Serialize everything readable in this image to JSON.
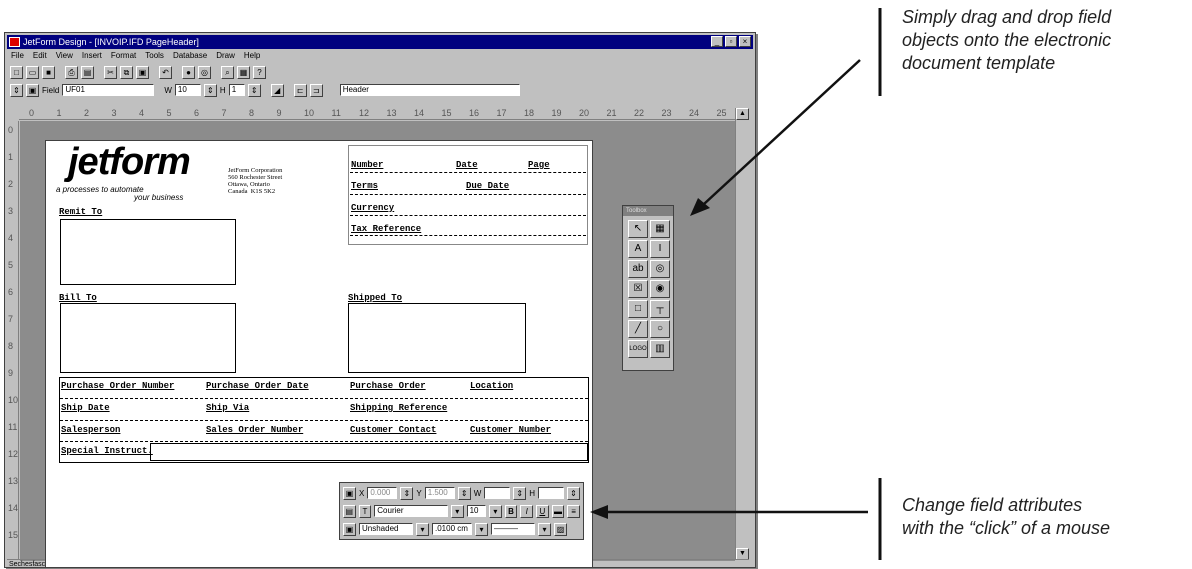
{
  "window": {
    "title": "JetForm Design - [INVOIP.IFD PageHeader]",
    "menus": [
      "File",
      "Edit",
      "View",
      "Insert",
      "Format",
      "Tools",
      "Database",
      "Draw",
      "Help"
    ]
  },
  "toolbar2": {
    "field_label": "Field",
    "field_value": "UF01",
    "width_label": "W",
    "width_value": "10",
    "height_label": "H",
    "height_value": "1",
    "section_value": "Header"
  },
  "ruler": {
    "h": [
      "0",
      "1",
      "2",
      "3",
      "4",
      "5",
      "6",
      "7",
      "8",
      "9",
      "10",
      "11",
      "12",
      "13",
      "14",
      "15",
      "16",
      "17",
      "18",
      "19",
      "20",
      "21",
      "22",
      "23",
      "24",
      "25"
    ],
    "v": [
      "0",
      "1",
      "2",
      "3",
      "4",
      "5",
      "6",
      "7",
      "8",
      "9",
      "10",
      "11",
      "12",
      "13",
      "14",
      "15"
    ]
  },
  "document": {
    "logo": "jetform",
    "tagline_1": "a processes to automate",
    "tagline_2": "your business",
    "address": "JetForm Corporation\n560 Rochester Street\nOttawa, Ontario\nCanada  K1S 5K2",
    "fields": {
      "number": "Number",
      "date": "Date",
      "page": "Page",
      "terms": "Terms",
      "due_date": "Due Date",
      "currency": "Currency",
      "tax_reference": "Tax Reference",
      "remit_to": "Remit To",
      "bill_to": "Bill To",
      "shipped_to": "Shipped To",
      "purchase_order_number": "Purchase Order Number",
      "purchase_order_date": "Purchase Order Date",
      "purchase_order": "Purchase Order",
      "location": "Location",
      "ship_date": "Ship Date",
      "ship_via": "Ship Via",
      "shipping_reference": "Shipping Reference",
      "salesperson": "Salesperson",
      "sales_order_number": "Sales Order Number",
      "customer_contact": "Customer Contact",
      "customer_number": "Customer Number",
      "special_instruct": "Special Instruct."
    }
  },
  "toolbox": {
    "title": "Toolbox",
    "tools": [
      {
        "icon": "pointer-icon",
        "glyph": "↖"
      },
      {
        "icon": "table-icon",
        "glyph": "▦"
      },
      {
        "icon": "text-icon",
        "glyph": "A"
      },
      {
        "icon": "ibeam-icon",
        "glyph": "I"
      },
      {
        "icon": "field-icon",
        "glyph": "ab"
      },
      {
        "icon": "picture-icon",
        "glyph": "◎"
      },
      {
        "icon": "checkbox-icon",
        "glyph": "☒"
      },
      {
        "icon": "radio-icon",
        "glyph": "◉"
      },
      {
        "icon": "box-icon",
        "glyph": "□"
      },
      {
        "icon": "line-tee-icon",
        "glyph": "┬"
      },
      {
        "icon": "diagonal-line-icon",
        "glyph": "╱"
      },
      {
        "icon": "circle-icon",
        "glyph": "○"
      },
      {
        "icon": "logo-icon",
        "glyph": "LOGO"
      },
      {
        "icon": "barcode-icon",
        "glyph": "▥"
      }
    ]
  },
  "attributes": {
    "x_label": "X",
    "x_value": "0.000",
    "y_label": "Y",
    "y_value": "1.500",
    "w_label": "W",
    "h_label": "H",
    "font_value": "Courier",
    "size_value": "10",
    "bold": "B",
    "italic": "I",
    "underline": "U",
    "frame_value": "Unshaded",
    "line_value": ".0100 cm"
  },
  "status": {
    "text": "Sechesfasc - Generic Microsoft Windows Driver"
  },
  "callouts": {
    "top": [
      "Simply drag and drop field",
      "objects onto the electronic",
      "document template"
    ],
    "bottom": [
      "Change field attributes",
      "with the “click” of a mouse"
    ]
  },
  "colors": {
    "titlebar": "#00007f",
    "window": "#c0c0c0",
    "canvas": "#8c8c8c"
  }
}
